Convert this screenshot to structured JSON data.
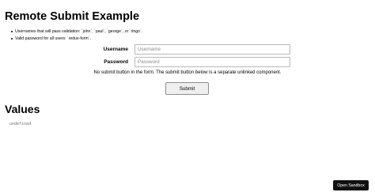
{
  "page_title": "Remote Submit Example",
  "instructions": [
    "Usernames that will pass validation: `john`, `paul`, `george`, or `ringo`.",
    "Valid password for all users: `redux-form`."
  ],
  "form": {
    "username": {
      "label": "Username",
      "value": "",
      "placeholder": "Username"
    },
    "password": {
      "label": "Password",
      "value": "",
      "placeholder": "Password"
    },
    "note": "No submit button in the form. The submit button below is a separate unlinked component."
  },
  "submit_button": {
    "label": "Submit"
  },
  "values_section": {
    "heading": "Values",
    "output": "undefined"
  },
  "sandbox_button": {
    "label": "Open Sandbox"
  }
}
